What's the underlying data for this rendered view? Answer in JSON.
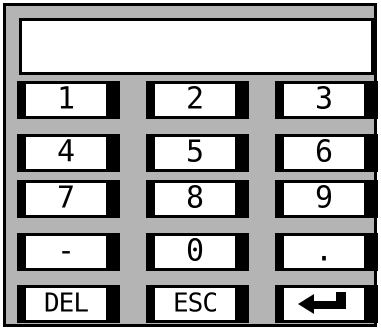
{
  "display": {
    "value": ""
  },
  "keys": [
    {
      "label": "1",
      "name": "key-1"
    },
    {
      "label": "2",
      "name": "key-2"
    },
    {
      "label": "3",
      "name": "key-3"
    },
    {
      "label": "4",
      "name": "key-4"
    },
    {
      "label": "5",
      "name": "key-5"
    },
    {
      "label": "6",
      "name": "key-6"
    },
    {
      "label": "7",
      "name": "key-7"
    },
    {
      "label": "8",
      "name": "key-8"
    },
    {
      "label": "9",
      "name": "key-9"
    },
    {
      "label": "-",
      "name": "key-minus"
    },
    {
      "label": "0",
      "name": "key-0"
    },
    {
      "label": ".",
      "name": "key-decimal"
    },
    {
      "label": "DEL",
      "name": "key-del"
    },
    {
      "label": "ESC",
      "name": "key-esc"
    },
    {
      "label": "",
      "name": "key-enter",
      "icon": "enter-arrow-icon"
    }
  ]
}
